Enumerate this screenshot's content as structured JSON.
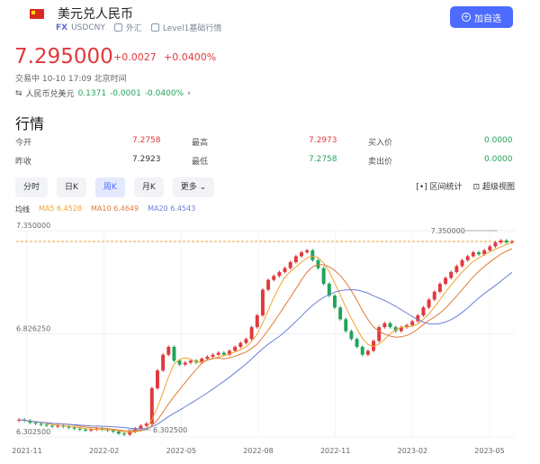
{
  "header": {
    "title": "美元兑人民币",
    "tag_fx": "FX",
    "symbol": "USDCNY",
    "market": "外汇",
    "level": "Level1基础行情",
    "add_label": "加自选"
  },
  "quote": {
    "price": "7.295000",
    "change": "+0.0027",
    "change_pct": "+0.0400%",
    "status": "交易中 10-10 17:09 北京时间",
    "inverse_label": "人民币兑美元",
    "inverse_price": "0.1371",
    "inverse_change": "-0.0001",
    "inverse_pct": "-0.0400%"
  },
  "section_title": "行情",
  "stats": {
    "open_label": "今开",
    "open": "7.2758",
    "high_label": "最高",
    "high": "7.2973",
    "bid_label": "买入价",
    "bid": "0.0000",
    "prev_label": "昨收",
    "prev": "7.2923",
    "low_label": "最低",
    "low": "7.2758",
    "ask_label": "卖出价",
    "ask": "0.0000"
  },
  "tabs": [
    "分时",
    "日K",
    "周K",
    "月K",
    "更多"
  ],
  "tools": {
    "range": "区间统计",
    "superview": "超级视图"
  },
  "ma": {
    "label": "均线",
    "ma5": "MA5 6.4528",
    "ma10": "MA10 6.4649",
    "ma20": "MA20 6.4543"
  },
  "colors": {
    "up": "#e0393e",
    "down": "#22a35b",
    "ma5": "#f0a32e",
    "ma10": "#e07b39",
    "ma20": "#6a7fd6",
    "accent": "#4d6bfe"
  },
  "chart_data": {
    "type": "candlestick",
    "period": "weekly",
    "ylim": [
      6.3025,
      7.35
    ],
    "y_ticks": [
      "7.350000",
      "6.826250",
      "6.302500"
    ],
    "x_ticks": [
      "2021-11",
      "2022-02",
      "2022-05",
      "2022-08",
      "2022-11",
      "2023-02",
      "2023-05"
    ],
    "annotations": {
      "max": "7.350000",
      "min": "6.302500"
    },
    "reference_line": 7.295,
    "closes": [
      6.39,
      6.385,
      6.375,
      6.37,
      6.365,
      6.36,
      6.355,
      6.36,
      6.355,
      6.35,
      6.345,
      6.34,
      6.335,
      6.34,
      6.345,
      6.34,
      6.335,
      6.33,
      6.32,
      6.315,
      6.33,
      6.345,
      6.36,
      6.37,
      6.55,
      6.64,
      6.72,
      6.76,
      6.69,
      6.67,
      6.68,
      6.69,
      6.68,
      6.7,
      6.71,
      6.72,
      6.73,
      6.72,
      6.74,
      6.76,
      6.78,
      6.8,
      6.86,
      6.92,
      7.05,
      7.1,
      7.12,
      7.14,
      7.16,
      7.19,
      7.22,
      7.24,
      7.25,
      7.2,
      7.16,
      7.08,
      7.02,
      6.96,
      6.9,
      6.84,
      6.8,
      6.76,
      6.72,
      6.74,
      6.79,
      6.86,
      6.88,
      6.86,
      6.84,
      6.86,
      6.87,
      6.89,
      6.92,
      6.96,
      7.0,
      7.04,
      7.08,
      7.11,
      7.14,
      7.17,
      7.2,
      7.22,
      7.24,
      7.23,
      7.25,
      7.27,
      7.29,
      7.3,
      7.29,
      7.295
    ]
  }
}
